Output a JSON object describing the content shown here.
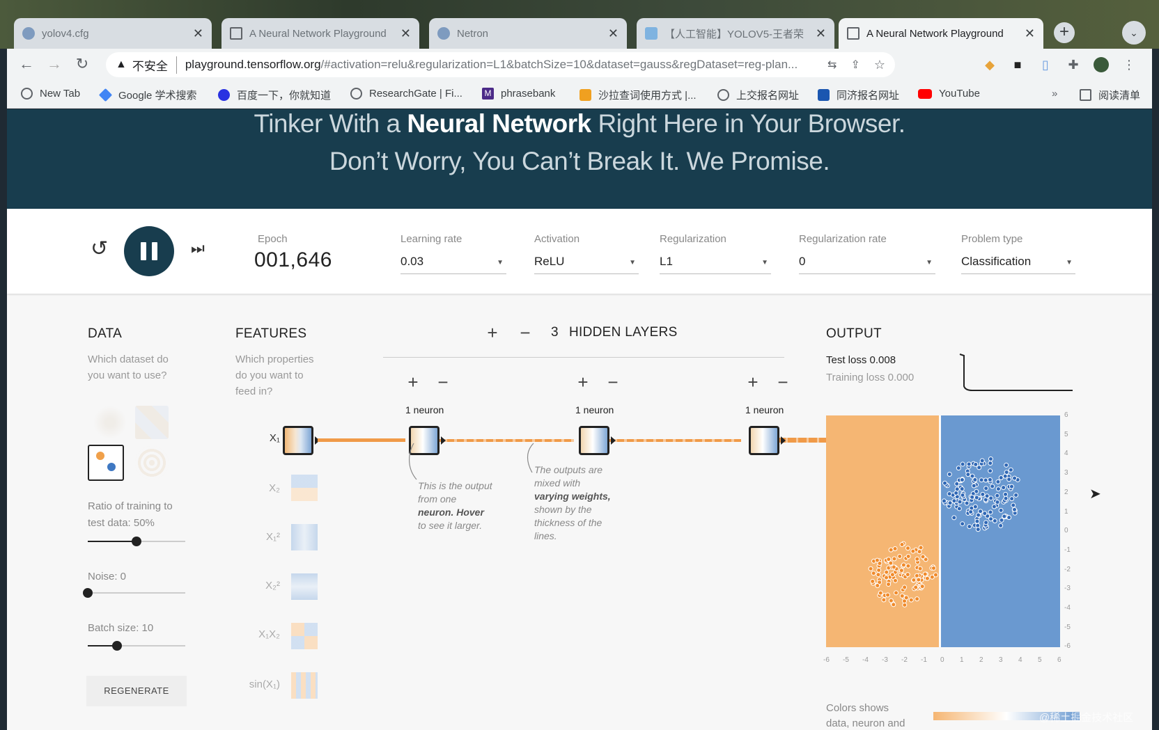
{
  "browser": {
    "tabs": [
      {
        "title": "yolov4.cfg",
        "icon": "globe-icon"
      },
      {
        "title": "A Neural Network Playground",
        "icon": "document-icon"
      },
      {
        "title": "Netron",
        "icon": "globe-icon"
      },
      {
        "title": "【人工智能】YOLOV5-王者荣",
        "icon": "video-icon"
      },
      {
        "title": "A Neural Network Playground",
        "icon": "document-icon",
        "active": true
      }
    ],
    "address": {
      "security_label": "不安全",
      "host": "playground.tensorflow.org",
      "path": "/#activation=relu&regularization=L1&batchSize=10&dataset=gauss&regDataset=reg-plan..."
    },
    "bookmarks": [
      {
        "label": "New Tab",
        "color": "#5f6368"
      },
      {
        "label": "Google 学术搜索",
        "color": "#4285f4"
      },
      {
        "label": "百度一下，你就知道",
        "color": "#2932e1"
      },
      {
        "label": "ResearchGate | Fi...",
        "color": "#5f6368"
      },
      {
        "label": "phrasebank",
        "color": "#4b2a88"
      },
      {
        "label": "沙拉查词使用方式 |...",
        "color": "#f0a020"
      },
      {
        "label": "上交报名网址",
        "color": "#5f6368"
      },
      {
        "label": "同济报名网址",
        "color": "#1a56b0"
      },
      {
        "label": "YouTube",
        "color": "#ff0000"
      }
    ],
    "bookmarks_overflow": "»",
    "reading_list": "阅读清单"
  },
  "hero": {
    "line1_pre": "Tinker With a ",
    "line1_bold": "Neural Network",
    "line1_post": " Right Here in Your Browser.",
    "line2": "Don’t Worry, You Can’t Break It. We Promise."
  },
  "controls": {
    "epoch_label": "Epoch",
    "epoch_value": "001,646",
    "learning_rate_label": "Learning rate",
    "learning_rate_value": "0.03",
    "activation_label": "Activation",
    "activation_value": "ReLU",
    "regularization_label": "Regularization",
    "regularization_value": "L1",
    "regularization_rate_label": "Regularization rate",
    "regularization_rate_value": "0",
    "problem_type_label": "Problem type",
    "problem_type_value": "Classification"
  },
  "data_panel": {
    "title": "DATA",
    "desc_line1": "Which dataset do",
    "desc_line2": "you want to use?",
    "ratio_label": "Ratio of training to",
    "ratio_label2": "test data:  50%",
    "ratio_value": 0.5,
    "noise_label": "Noise:  0",
    "noise_value": 0,
    "batch_label": "Batch size:  10",
    "batch_value": 0.3,
    "regenerate": "REGENERATE"
  },
  "features_panel": {
    "title": "FEATURES",
    "desc_line1": "Which properties",
    "desc_line2": "do you want to",
    "desc_line3": "feed in?",
    "features": [
      {
        "label": "X₁",
        "active": true
      },
      {
        "label": "X₂",
        "active": false
      },
      {
        "label": "X₁²",
        "active": false
      },
      {
        "label": "X₂²",
        "active": false
      },
      {
        "label": "X₁X₂",
        "active": false
      },
      {
        "label": "sin(X₁)",
        "active": false
      }
    ]
  },
  "network": {
    "add": "+",
    "remove": "−",
    "hidden_layers_count": "3",
    "hidden_layers_label": "HIDDEN LAYERS",
    "layers": [
      {
        "neurons": "1 neuron"
      },
      {
        "neurons": "1 neuron"
      },
      {
        "neurons": "1 neuron"
      }
    ],
    "annotation1": [
      "This is the output",
      "from one",
      "neuron. Hover",
      "to see it larger."
    ],
    "annotation2": [
      "The outputs are",
      "mixed with",
      "varying weights,",
      "shown by the",
      "thickness of the",
      "lines."
    ]
  },
  "output_panel": {
    "title": "OUTPUT",
    "test_loss": "Test loss 0.008",
    "training_loss": "Training loss 0.000",
    "x_ticks": [
      "-6",
      "-5",
      "-4",
      "-3",
      "-2",
      "-1",
      "0",
      "1",
      "2",
      "3",
      "4",
      "5",
      "6"
    ],
    "y_ticks": [
      "6",
      "5",
      "4",
      "3",
      "2",
      "1",
      "0",
      "-1",
      "-2",
      "-3",
      "-4",
      "-5",
      "-6"
    ],
    "colors_label_line1": "Colors shows",
    "colors_label_line2": "data, neuron and",
    "orange": "#f5b673",
    "blue": "#6a99d0"
  },
  "watermark": "@稀土掘金技术社区"
}
